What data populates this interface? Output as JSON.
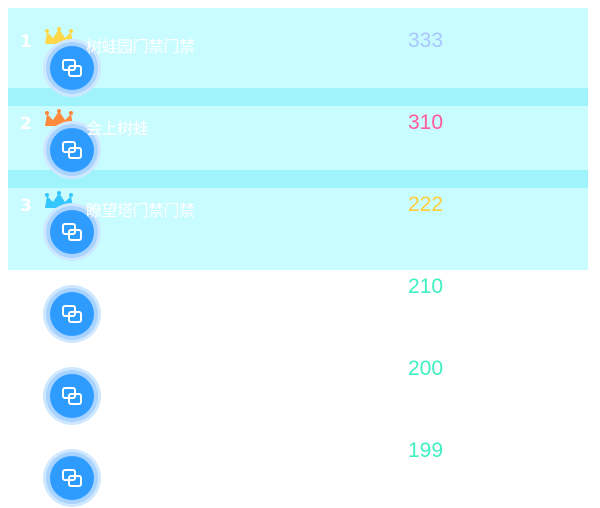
{
  "colors": {
    "band_light": "#c9fcff",
    "band_dark": "#9ef4fa",
    "avatar_blue": "#2e9bff",
    "avatar_ring": "#bfe2ff"
  },
  "rows": [
    {
      "rank": "1",
      "name": "树蛙园门禁门禁",
      "score": "333",
      "score_color": "#a9c6ff",
      "crown_color": "#ffd84a"
    },
    {
      "rank": "2",
      "name": "会上树蛙",
      "score": "310",
      "score_color": "#ff5b9a",
      "crown_color": "#ff8a3d"
    },
    {
      "rank": "3",
      "name": "瞭望塔门禁门禁",
      "score": "222",
      "score_color": "#ffcc3a",
      "crown_color": "#36c6ff"
    },
    {
      "rank": "",
      "name": "",
      "score": "210",
      "score_color": "#3ff0c2",
      "crown_color": ""
    },
    {
      "rank": "",
      "name": "",
      "score": "200",
      "score_color": "#3ff0c2",
      "crown_color": ""
    },
    {
      "rank": "",
      "name": "",
      "score": "199",
      "score_color": "#3ff0c2",
      "crown_color": ""
    }
  ]
}
